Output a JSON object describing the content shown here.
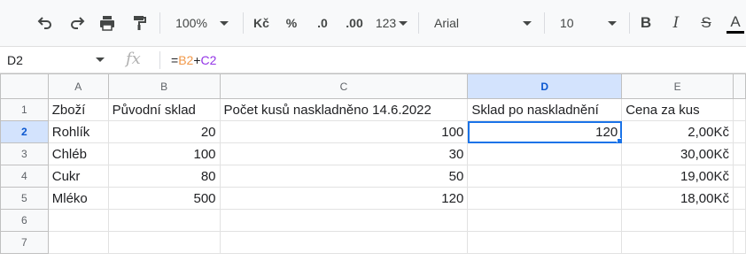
{
  "toolbar": {
    "zoom": "100%",
    "currency": "Kč",
    "percent": "%",
    "decrease_decimal": ".0",
    "increase_decimal": ".00",
    "more_formats": "123",
    "font": "Arial",
    "font_size": "10",
    "bold": "B",
    "italic": "I",
    "strikethrough": "S",
    "text_color": "A"
  },
  "formula_bar": {
    "cell_ref": "D2",
    "fx": "fx",
    "formula_eq": "=",
    "formula_ref1": "B2",
    "formula_plus": "+",
    "formula_ref2": "C2"
  },
  "columns": [
    "A",
    "B",
    "C",
    "D",
    "E"
  ],
  "rows": [
    {
      "num": "1",
      "a": "Zboží",
      "b": "Původní sklad",
      "c": "Počet kusů naskladněno 14.6.2022",
      "d": "Sklad po naskladnění",
      "e": "Cena za kus"
    },
    {
      "num": "2",
      "a": "Rohlík",
      "b": "20",
      "c": "100",
      "d": "120",
      "e": "2,00Kč"
    },
    {
      "num": "3",
      "a": "Chléb",
      "b": "100",
      "c": "30",
      "d": "",
      "e": "30,00Kč"
    },
    {
      "num": "4",
      "a": "Cukr",
      "b": "80",
      "c": "50",
      "d": "",
      "e": "19,00Kč"
    },
    {
      "num": "5",
      "a": "Mléko",
      "b": "500",
      "c": "120",
      "d": "",
      "e": "18,00Kč"
    },
    {
      "num": "6",
      "a": "",
      "b": "",
      "c": "",
      "d": "",
      "e": ""
    },
    {
      "num": "7",
      "a": "",
      "b": "",
      "c": "",
      "d": "",
      "e": ""
    }
  ],
  "colors": {
    "selection": "#1a73e8",
    "header_selected": "#d3e3fd",
    "ref_b2": "#f2994a",
    "ref_c2": "#9334e6"
  }
}
